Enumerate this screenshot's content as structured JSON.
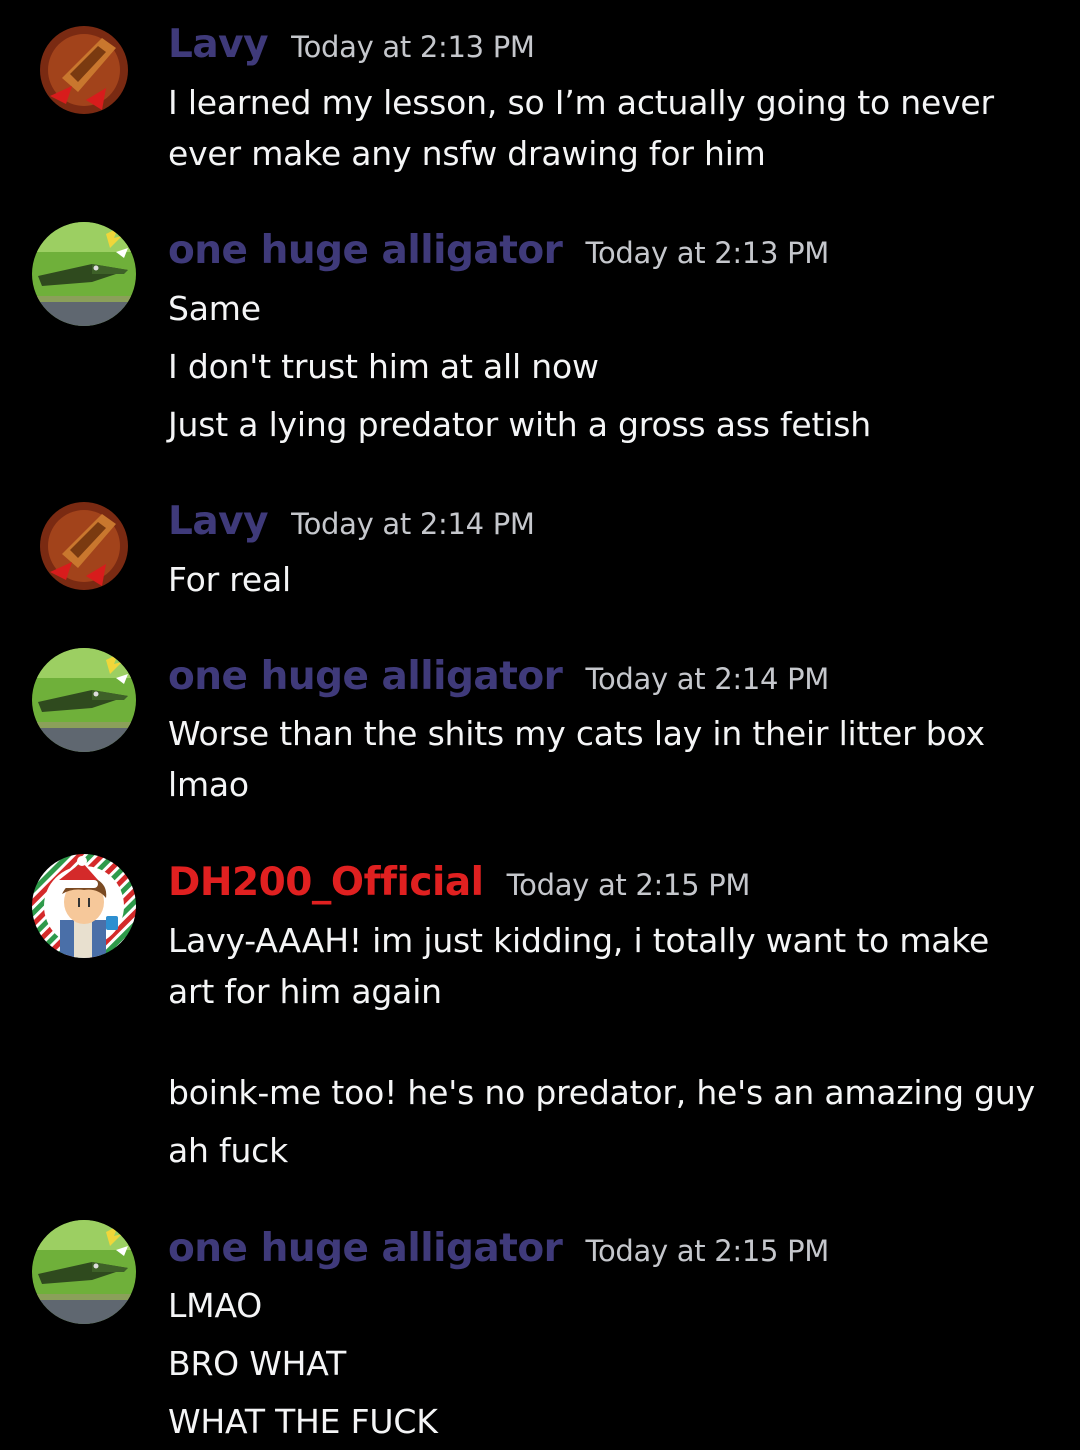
{
  "colors": {
    "background": "#000000",
    "lavy_name": "#3f3a7a",
    "alligator_name": "#3f3a7a",
    "dh200_name": "#e02020",
    "timestamp": "#c5c7cc",
    "text": "#f4f5f6"
  },
  "messages": [
    {
      "author": "Lavy",
      "avatar": "lavy-avatar-icon",
      "timestamp": "Today at 2:13 PM",
      "lines": [
        "I learned my lesson, so I’m actually going to never",
        "ever make any nsfw drawing for him"
      ]
    },
    {
      "author": "one huge alligator",
      "avatar": "alligator-avatar-icon",
      "timestamp": "Today at 2:13 PM",
      "lines": [
        "Same",
        "I don't trust him at all now",
        "Just a lying predator with a gross ass fetish"
      ]
    },
    {
      "author": "Lavy",
      "avatar": "lavy-avatar-icon",
      "timestamp": "Today at 2:14 PM",
      "lines": [
        "For real"
      ]
    },
    {
      "author": "one huge alligator",
      "avatar": "alligator-avatar-icon",
      "timestamp": "Today at 2:14 PM",
      "lines": [
        "Worse than the shits my cats lay in their litter box",
        "lmao"
      ]
    },
    {
      "author": "DH200_Official",
      "avatar": "dh200-avatar-icon",
      "timestamp": "Today at 2:15 PM",
      "lines": [
        "Lavy-AAAH! im just kidding, i totally want to make",
        "art for him again",
        "boink-me too! he's no predator, he's an amazing guy",
        "ah fuck"
      ]
    },
    {
      "author": "one huge alligator",
      "avatar": "alligator-avatar-icon",
      "timestamp": "Today at 2:15 PM",
      "lines": [
        "LMAO",
        "BRO WHAT",
        "WHAT THE FUCK"
      ]
    }
  ]
}
